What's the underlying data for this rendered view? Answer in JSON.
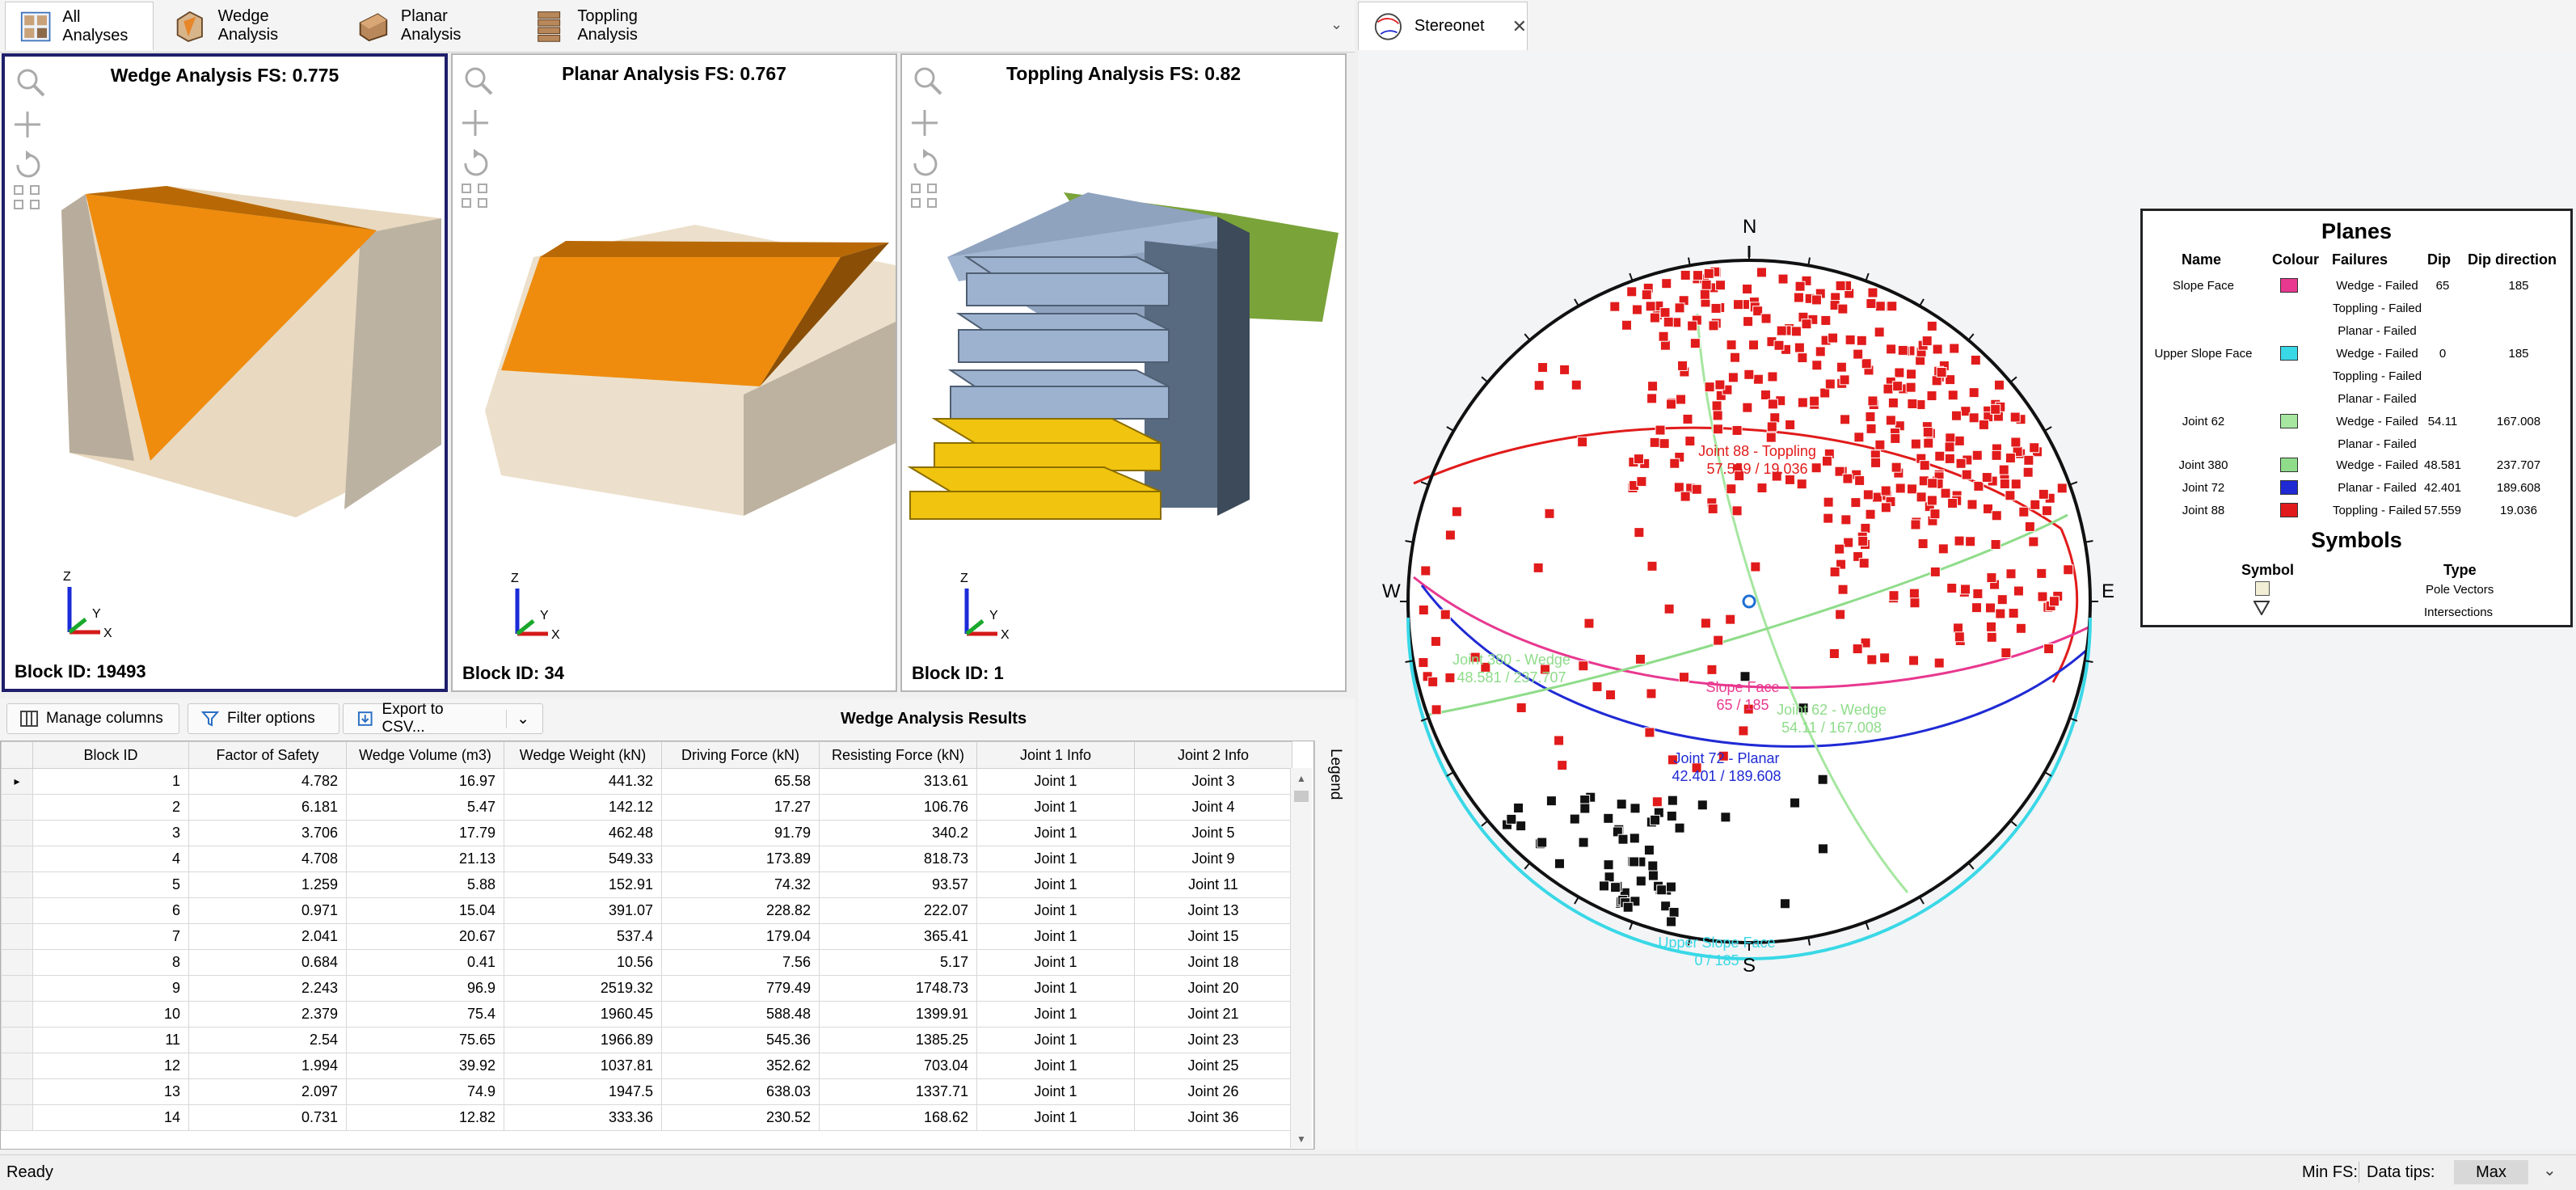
{
  "tabs": [
    {
      "label": "All Analyses"
    },
    {
      "label": "Wedge Analysis"
    },
    {
      "label": "Planar Analysis"
    },
    {
      "label": "Toppling Analysis"
    }
  ],
  "viewports": {
    "wedge": {
      "title": "Wedge Analysis FS: 0.775",
      "block": "Block ID: 19493"
    },
    "planar": {
      "title": "Planar Analysis FS: 0.767",
      "block": "Block ID: 34"
    },
    "toppling": {
      "title": "Toppling Analysis FS: 0.82",
      "block": "Block ID: 1"
    },
    "axis_labels": {
      "z": "Z",
      "y": "Y",
      "x": "X"
    }
  },
  "grid_toolbar": {
    "manage_columns": "Manage columns",
    "filter_options": "Filter options",
    "export_csv": "Export to CSV...",
    "title": "Wedge Analysis Results"
  },
  "table": {
    "columns": [
      "Block ID",
      "Factor of Safety",
      "Wedge Volume (m3)",
      "Wedge Weight (kN)",
      "Driving Force (kN)",
      "Resisting Force (kN)",
      "Joint 1 Info",
      "Joint 2 Info"
    ],
    "rows": [
      [
        "1",
        "4.782",
        "16.97",
        "441.32",
        "65.58",
        "313.61",
        "Joint 1",
        "Joint 3"
      ],
      [
        "2",
        "6.181",
        "5.47",
        "142.12",
        "17.27",
        "106.76",
        "Joint 1",
        "Joint 4"
      ],
      [
        "3",
        "3.706",
        "17.79",
        "462.48",
        "91.79",
        "340.2",
        "Joint 1",
        "Joint 5"
      ],
      [
        "4",
        "4.708",
        "21.13",
        "549.33",
        "173.89",
        "818.73",
        "Joint 1",
        "Joint 9"
      ],
      [
        "5",
        "1.259",
        "5.88",
        "152.91",
        "74.32",
        "93.57",
        "Joint 1",
        "Joint 11"
      ],
      [
        "6",
        "0.971",
        "15.04",
        "391.07",
        "228.82",
        "222.07",
        "Joint 1",
        "Joint 13"
      ],
      [
        "7",
        "2.041",
        "20.67",
        "537.4",
        "179.04",
        "365.41",
        "Joint 1",
        "Joint 15"
      ],
      [
        "8",
        "0.684",
        "0.41",
        "10.56",
        "7.56",
        "5.17",
        "Joint 1",
        "Joint 18"
      ],
      [
        "9",
        "2.243",
        "96.9",
        "2519.32",
        "779.49",
        "1748.73",
        "Joint 1",
        "Joint 20"
      ],
      [
        "10",
        "2.379",
        "75.4",
        "1960.45",
        "588.48",
        "1399.91",
        "Joint 1",
        "Joint 21"
      ],
      [
        "11",
        "2.54",
        "75.65",
        "1966.89",
        "545.36",
        "1385.25",
        "Joint 1",
        "Joint 23"
      ],
      [
        "12",
        "1.994",
        "39.92",
        "1037.81",
        "352.62",
        "703.04",
        "Joint 1",
        "Joint 25"
      ],
      [
        "13",
        "2.097",
        "74.9",
        "1947.5",
        "638.03",
        "1337.71",
        "Joint 1",
        "Joint 26"
      ],
      [
        "14",
        "0.731",
        "12.82",
        "333.36",
        "230.52",
        "168.62",
        "Joint 1",
        "Joint 36"
      ]
    ]
  },
  "legend_tab": "Legend",
  "stereonet": {
    "tab_label": "Stereonet",
    "directions": {
      "n": "N",
      "s": "S",
      "e": "E",
      "w": "W"
    },
    "plane_labels": {
      "slope_face": "Slope Face",
      "slope_face_dd": "65 / 185",
      "joint62": "Joint 62 - Wedge",
      "joint62_dd": "54.11 / 167.008",
      "joint380": "Joint 380 - Wedge",
      "joint380_dd": "48.581 / 237.707",
      "joint72": "Joint 72 - Planar",
      "joint72_dd": "42.401 / 189.608",
      "joint88": "Joint 88 - Toppling",
      "joint88_dd": "57.559 / 19.036",
      "upper": "Upper Slope Face",
      "upper_dd": "0 / 185"
    },
    "colors": {
      "slope_face": "#e8388f",
      "upper_slope_face": "#39d8e6",
      "joint62": "#a6e6a0",
      "joint380": "#8fdc8a",
      "joint72": "#1f2ad4",
      "joint88": "#e11b1b",
      "pole": "#e11b1b",
      "intersection": "#111111"
    }
  },
  "legend": {
    "planes_title": "Planes",
    "headers": {
      "name": "Name",
      "colour": "Colour",
      "failures": "Failures",
      "dip": "Dip",
      "dip_direction": "Dip direction"
    },
    "rows": [
      {
        "name": "Slope Face",
        "color": "#e8388f",
        "failures": [
          "Wedge - Failed",
          "Toppling - Failed",
          "Planar - Failed"
        ],
        "dip": "65",
        "dd": "185"
      },
      {
        "name": "Upper Slope Face",
        "color": "#39d8e6",
        "failures": [
          "Wedge - Failed",
          "Toppling - Failed",
          "Planar - Failed"
        ],
        "dip": "0",
        "dd": "185"
      },
      {
        "name": "Joint 62",
        "color": "#a6e6a0",
        "failures": [
          "Wedge - Failed",
          "Planar - Failed"
        ],
        "dip": "54.11",
        "dd": "167.008"
      },
      {
        "name": "Joint 380",
        "color": "#8fdc8a",
        "failures": [
          "Wedge - Failed"
        ],
        "dip": "48.581",
        "dd": "237.707"
      },
      {
        "name": "Joint 72",
        "color": "#1f2ad4",
        "failures": [
          "Planar - Failed"
        ],
        "dip": "42.401",
        "dd": "189.608"
      },
      {
        "name": "Joint 88",
        "color": "#e11b1b",
        "failures": [
          "Toppling - Failed"
        ],
        "dip": "57.559",
        "dd": "19.036"
      }
    ],
    "symbols_title": "Symbols",
    "symbol_headers": {
      "symbol": "Symbol",
      "type": "Type"
    },
    "symbol_types": [
      "Pole Vectors",
      "Intersections"
    ]
  },
  "status": {
    "ready": "Ready",
    "min_fs": "Min FS:",
    "data_tips": "Data tips:",
    "data_tips_value": "Max"
  }
}
